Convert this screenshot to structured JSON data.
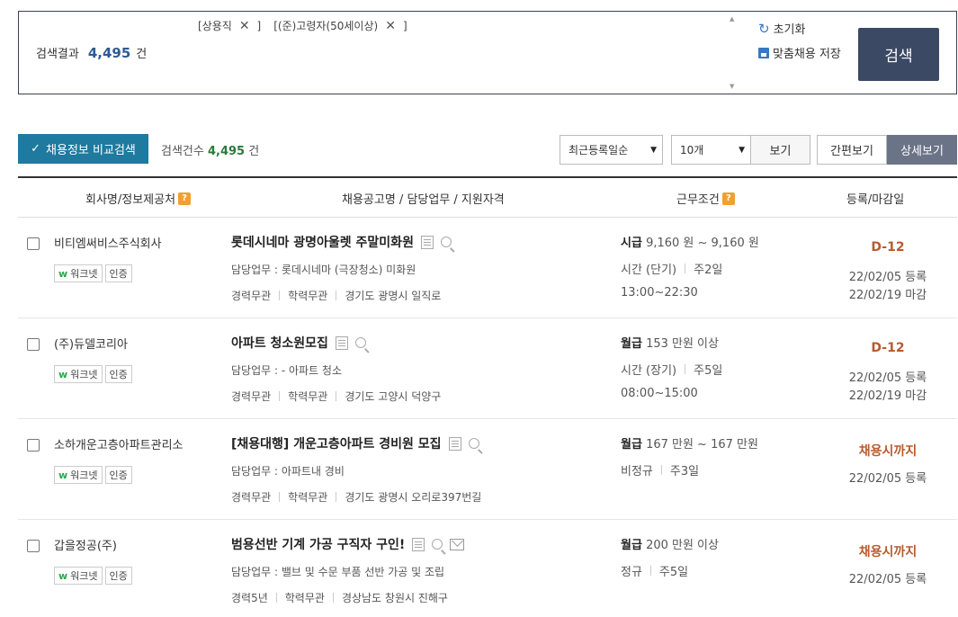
{
  "filters": {
    "chips": [
      {
        "label": "[상용직"
      },
      {
        "label": "[(준)고령자(50세이상)"
      }
    ],
    "close_glyph": "✕",
    "result_label": "검색결과",
    "result_count": "4,495",
    "result_unit": "건",
    "reset_label": "초기화",
    "save_label": "맞춤채용 저장",
    "search_label": "검색",
    "bracket_close": "]"
  },
  "toolbar": {
    "compare_label": "채용정보 비교검색",
    "count_label": "검색건수",
    "count_value": "4,495",
    "count_unit": "건",
    "sort_value": "최근등록일순",
    "per_page_value": "10개",
    "view_label": "보기",
    "simple_label": "간편보기",
    "detail_label": "상세보기"
  },
  "table": {
    "headers": {
      "company": "회사명/정보제공처",
      "posting": "채용공고명 / 담당업무 / 지원자격",
      "conditions": "근무조건",
      "dates": "등록/마감일"
    },
    "badge_worknet": "워크넷",
    "badge_cert": "인증",
    "rows": [
      {
        "company": "비티엠써비스주식회사",
        "title": "롯데시네마 광명아울렛 주말미화원",
        "duty": "담당업무 : 롯데시네마 (극장청소) 미화원",
        "career": "경력무관",
        "education": "학력무관",
        "location": "경기도 광명시 일직로",
        "pay_type": "시급",
        "pay": "9,160 원 ~ 9,160 원",
        "work_type": "시간 (단기)",
        "work_days": "주2일",
        "hours": "13:00~22:30",
        "deadline": "D-12",
        "registered": "22/02/05 등록",
        "closing": "22/02/19 마감"
      },
      {
        "company": "(주)듀델코리아",
        "title": "아파트 청소원모집",
        "duty": "담당업무 : - 아파트 청소",
        "career": "경력무관",
        "education": "학력무관",
        "location": "경기도 고양시 덕양구",
        "pay_type": "월급",
        "pay": "153 만원 이상",
        "work_type": "시간 (장기)",
        "work_days": "주5일",
        "hours": "08:00~15:00",
        "deadline": "D-12",
        "registered": "22/02/05 등록",
        "closing": "22/02/19 마감"
      },
      {
        "company": "소하개운고층아파트관리소",
        "title": "[채용대행] 개운고층아파트 경비원 모집",
        "duty": "담당업무 : 아파트내 경비",
        "career": "경력무관",
        "education": "학력무관",
        "location": "경기도 광명시 오리로397번길",
        "pay_type": "월급",
        "pay": "167 만원 ~ 167 만원",
        "work_type": "비정규",
        "work_days": "주3일",
        "deadline": "채용시까지",
        "registered": "22/02/05 등록"
      },
      {
        "company": "갑을정공(주)",
        "title": "범용선반 기계 가공 구직자 구인!",
        "duty": "담당업무 : 밸브 및 수문 부품 선반 가공 및 조립",
        "career": "경력5년",
        "education": "학력무관",
        "location": "경상남도 창원시 진해구",
        "pay_type": "월급",
        "pay": "200 만원 이상",
        "work_type": "정규",
        "work_days": "주5일",
        "deadline": "채용시까지",
        "registered": "22/02/05 등록"
      }
    ]
  }
}
